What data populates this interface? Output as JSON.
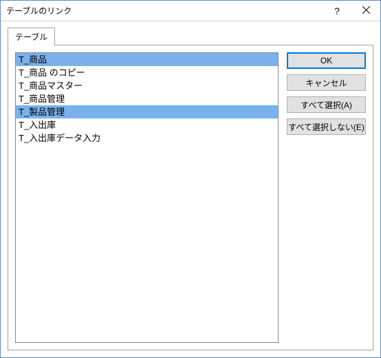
{
  "dialog": {
    "title": "テーブルのリンク",
    "help_symbol": "?",
    "tab_label": "テーブル"
  },
  "tables": {
    "items": [
      {
        "label": "T_商品",
        "selected": true
      },
      {
        "label": "T_商品 のコピー",
        "selected": false
      },
      {
        "label": "T_商品マスター",
        "selected": false
      },
      {
        "label": "T_商品管理",
        "selected": false
      },
      {
        "label": "T_製品管理",
        "selected": true
      },
      {
        "label": "T_入出庫",
        "selected": false
      },
      {
        "label": "T_入出庫データ入力",
        "selected": false
      }
    ]
  },
  "buttons": {
    "ok": "OK",
    "cancel": "キャンセル",
    "select_all": "すべて選択(A)",
    "deselect_all": "すべて選択しない(E)"
  }
}
